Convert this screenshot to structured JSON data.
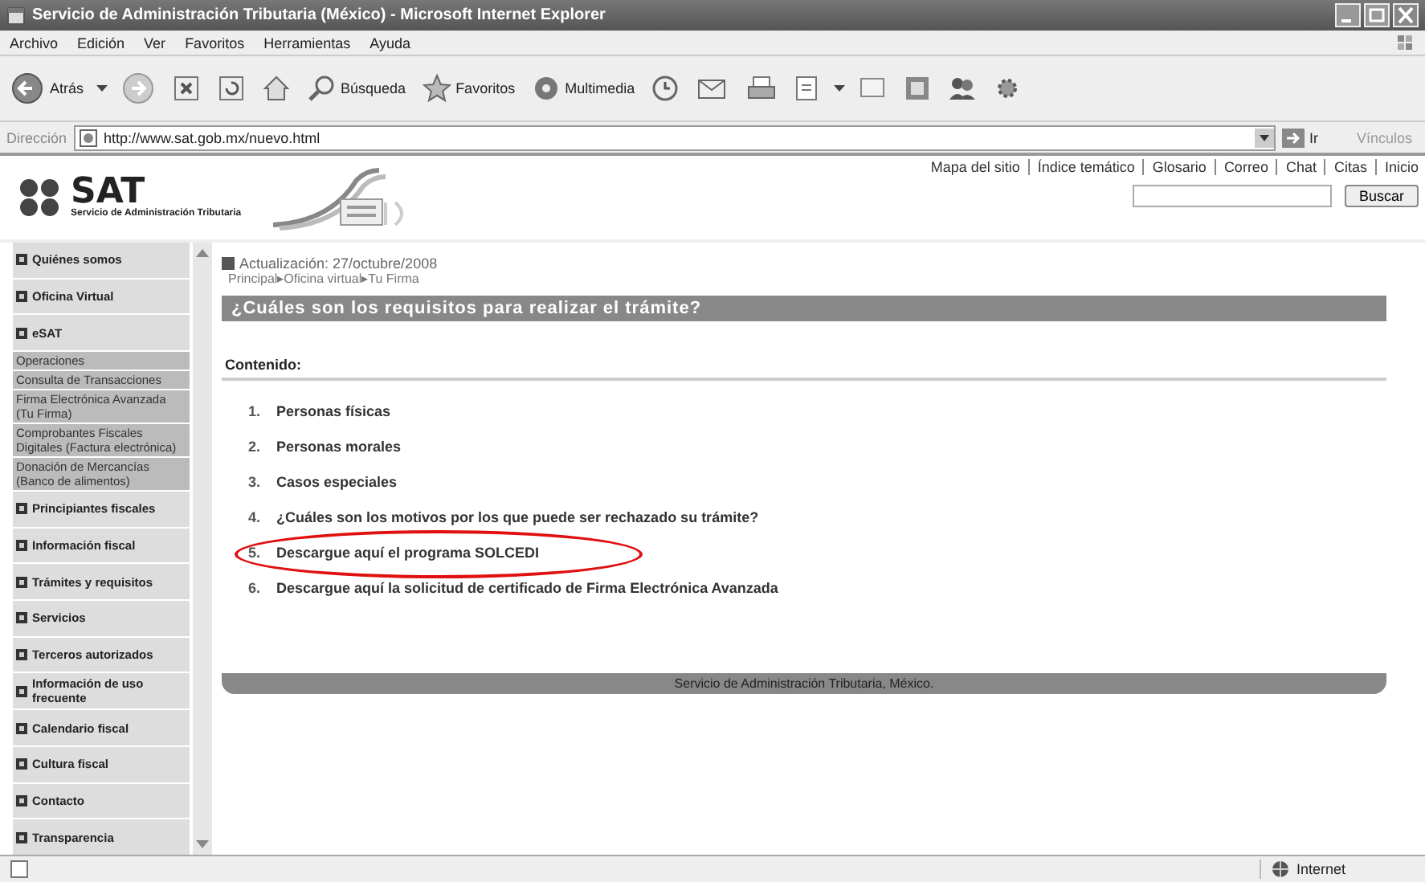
{
  "window": {
    "title": "Servicio de Administración Tributaria (México) - Microsoft Internet Explorer"
  },
  "menu": [
    "Archivo",
    "Edición",
    "Ver",
    "Favoritos",
    "Herramientas",
    "Ayuda"
  ],
  "toolbar": [
    {
      "label": "Atrás"
    },
    {
      "label": "Búsqueda"
    },
    {
      "label": "Favoritos"
    },
    {
      "label": "Multimedia"
    }
  ],
  "address": {
    "label": "Dirección",
    "value": "http://www.sat.gob.mx/nuevo.html",
    "go": "Ir",
    "links": "Vínculos"
  },
  "site": {
    "logo": "SAT",
    "logo_subtitle": "Servicio de Administración Tributaria",
    "top_links": [
      "Mapa del sitio",
      "Índice temático",
      "Glosario",
      "Correo",
      "Chat",
      "Citas",
      "Inicio"
    ],
    "search_button": "Buscar"
  },
  "sidebar": {
    "items": [
      {
        "label": "Quiénes somos",
        "kind": "main"
      },
      {
        "label": "Oficina Virtual",
        "kind": "main"
      },
      {
        "label": "eSAT",
        "kind": "main"
      },
      {
        "label": "Operaciones",
        "kind": "sub"
      },
      {
        "label": "Consulta de Transacciones",
        "kind": "sub"
      },
      {
        "label": "Firma Electrónica Avanzada (Tu Firma)",
        "kind": "sub"
      },
      {
        "label": "Comprobantes Fiscales Digitales (Factura electrónica)",
        "kind": "sub"
      },
      {
        "label": "Donación de Mercancías (Banco de alimentos)",
        "kind": "sub"
      },
      {
        "label": "Principiantes fiscales",
        "kind": "main"
      },
      {
        "label": "Información fiscal",
        "kind": "main"
      },
      {
        "label": "Trámites y requisitos",
        "kind": "main"
      },
      {
        "label": "Servicios",
        "kind": "main"
      },
      {
        "label": "Terceros autorizados",
        "kind": "main"
      },
      {
        "label": "Información de uso frecuente",
        "kind": "main"
      },
      {
        "label": "Calendario fiscal",
        "kind": "main"
      },
      {
        "label": "Cultura fiscal",
        "kind": "main"
      },
      {
        "label": "Contacto",
        "kind": "main"
      },
      {
        "label": "Transparencia",
        "kind": "main"
      }
    ]
  },
  "content": {
    "updated": "Actualización: 27/octubre/2008",
    "breadcrumb": "Principal▸Oficina virtual▸Tu Firma",
    "heading": "¿Cuáles son los requisitos para realizar el trámite?",
    "contents_label": "Contenido:",
    "items": [
      {
        "number": "1.",
        "text": "Personas físicas",
        "circled": false
      },
      {
        "number": "2.",
        "text": "Personas morales",
        "circled": false
      },
      {
        "number": "3.",
        "text": "Casos especiales",
        "circled": false
      },
      {
        "number": "4.",
        "text": "¿Cuáles son los motivos por los que puede ser rechazado su trámite?",
        "circled": false
      },
      {
        "number": "5.",
        "text": "Descargue aquí el programa SOLCEDI",
        "circled": true
      },
      {
        "number": "6.",
        "text": "Descargue aquí la solicitud de certificado de Firma Electrónica Avanzada",
        "circled": false
      }
    ],
    "footer": "Servicio de Administración Tributaria, México."
  },
  "status_bar": {
    "zone": "Internet"
  }
}
